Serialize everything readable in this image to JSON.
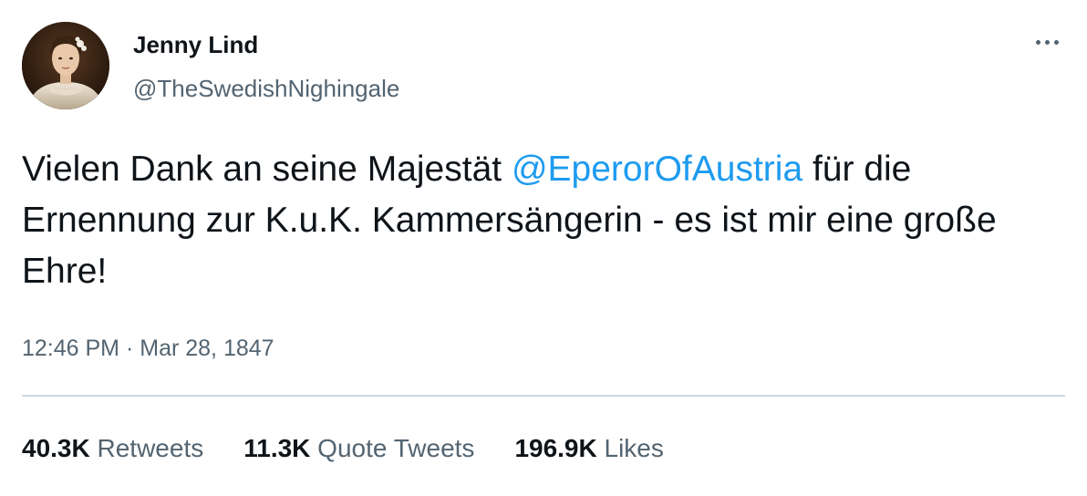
{
  "author": {
    "display_name": "Jenny Lind",
    "handle": "@TheSwedishNighingale"
  },
  "tweet": {
    "text_before": "Vielen Dank an seine Majestät ",
    "mention": "@EperorOfAustria",
    "text_after": " für die Ernennung zur K.u.K. Kammersängerin - es ist mir eine große Ehre!",
    "time": "12:46 PM",
    "separator": "·",
    "date": "Mar 28, 1847"
  },
  "stats": {
    "retweets_count": "40.3K",
    "retweets_label": "Retweets",
    "quotes_count": "11.3K",
    "quotes_label": "Quote Tweets",
    "likes_count": "196.9K",
    "likes_label": "Likes"
  },
  "icons": {
    "more": "more-horizontal-icon",
    "avatar": "portrait-avatar"
  },
  "colors": {
    "text": "#0f1419",
    "secondary": "#536471",
    "link": "#1d9bf0",
    "divider": "#cfd9de"
  }
}
